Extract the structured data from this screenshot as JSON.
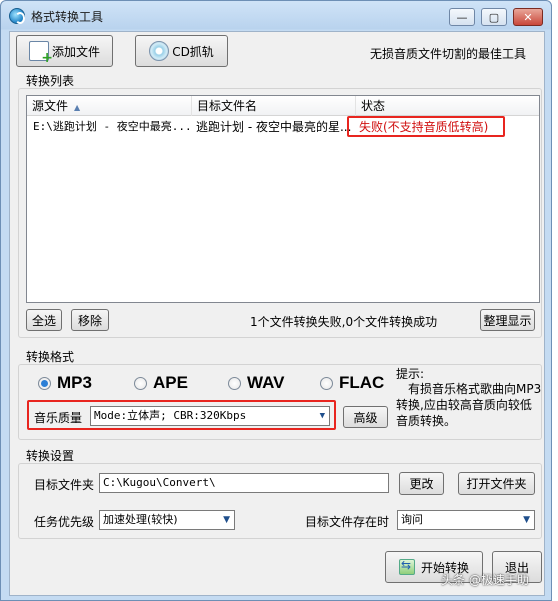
{
  "window": {
    "title": "格式转换工具",
    "controls": {
      "minimize": "—",
      "maximize": "▢",
      "close": "✕"
    }
  },
  "toolbar": {
    "add_file": "添加文件",
    "cd_rip": "CD抓轨",
    "slogan": "无损音质文件切割的最佳工具"
  },
  "convert_list": {
    "label": "转换列表",
    "columns": [
      "源文件",
      "目标文件名",
      "状态"
    ],
    "rows": [
      {
        "source": "E:\\逃跑计划 - 夜空中最亮...",
        "target": "逃跑计划 - 夜空中最亮的星...",
        "status": "失败(不支持音质低转高)"
      }
    ],
    "select_all": "全选",
    "remove": "移除",
    "summary": "1个文件转换失败,0个文件转换成功",
    "tidy_display": "整理显示"
  },
  "format": {
    "label": "转换格式",
    "options": [
      {
        "name": "MP3",
        "selected": true
      },
      {
        "name": "APE",
        "selected": false
      },
      {
        "name": "WAV",
        "selected": false
      },
      {
        "name": "FLAC",
        "selected": false
      }
    ],
    "hint_title": "提示:",
    "hint_text": "有损音乐格式歌曲向MP3转换,应由较高音质向较低音质转换。",
    "quality_label": "音乐质量",
    "quality_value": "Mode:立体声; CBR:320Kbps",
    "advanced": "高级"
  },
  "settings": {
    "label": "转换设置",
    "target_folder_label": "目标文件夹",
    "target_folder_value": "C:\\Kugou\\Convert\\",
    "change": "更改",
    "open_folder": "打开文件夹",
    "priority_label": "任务优先级",
    "priority_value": "加速处理(较快)",
    "exists_label": "目标文件存在时",
    "exists_value": "询问"
  },
  "actions": {
    "start": "开始转换",
    "exit": "退出"
  },
  "watermark": "头条 @极速手助",
  "colors": {
    "highlight": "#e8251f",
    "fail_text": "#d01010",
    "radio_selected": "#2c7fd6"
  }
}
